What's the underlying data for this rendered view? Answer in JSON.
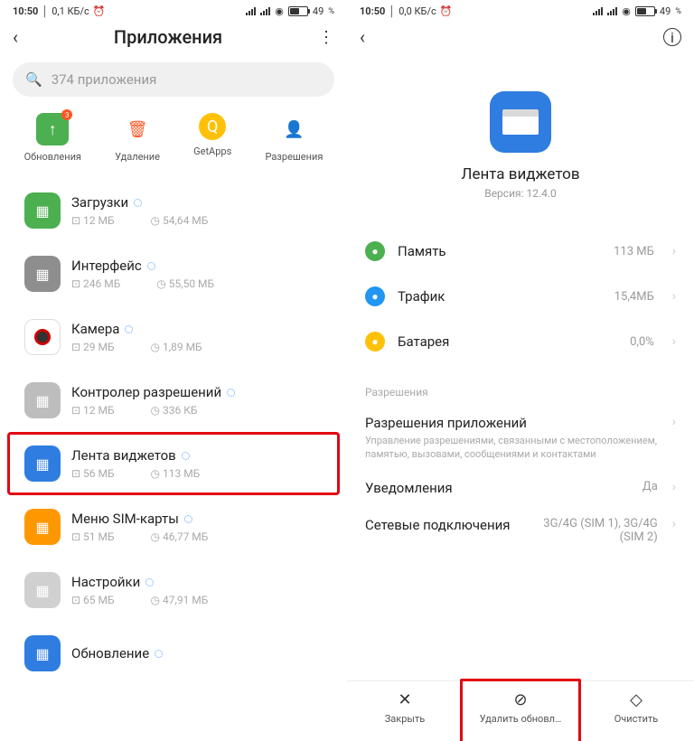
{
  "status": {
    "time": "10:50",
    "speed_l": "0,1 КБ/с",
    "speed_r": "0,0 КБ/с",
    "battery": "49"
  },
  "left": {
    "title": "Приложения",
    "search_placeholder": "374 приложения",
    "quick": [
      {
        "label": "Обновления",
        "badge": "3"
      },
      {
        "label": "Удаление"
      },
      {
        "label": "GetApps"
      },
      {
        "label": "Разрешения"
      }
    ],
    "apps": [
      {
        "name": "Загрузки",
        "install": "12 МБ",
        "storage": "54,64 МБ",
        "color": "#4caf50"
      },
      {
        "name": "Интерфейс",
        "install": "246 МБ",
        "storage": "55,50 МБ",
        "color": "#8e8e8e"
      },
      {
        "name": "Камера",
        "install": "29 МБ",
        "storage": "1,89 МБ",
        "color": "#fff"
      },
      {
        "name": "Контролер разрешений",
        "install": "12 МБ",
        "storage": "336 КБ",
        "color": "#bdbdbd"
      },
      {
        "name": "Лента виджетов",
        "install": "56 МБ",
        "storage": "113 МБ",
        "color": "#2f7de0",
        "hl": true
      },
      {
        "name": "Меню SIM-карты",
        "install": "51 МБ",
        "storage": "46,77 МБ",
        "color": "#ff9800"
      },
      {
        "name": "Настройки",
        "install": "65 МБ",
        "storage": "47,91 МБ",
        "color": "#d0d0d0"
      },
      {
        "name": "Обновление",
        "install": "",
        "storage": "",
        "color": "#2f7de0"
      }
    ]
  },
  "right": {
    "app_name": "Лента виджетов",
    "version": "Версия: 12.4.0",
    "details": [
      {
        "label": "Память",
        "value": "113 МБ",
        "icon_color": "#4caf50"
      },
      {
        "label": "Трафик",
        "value": "15,4МБ",
        "icon_color": "#2196f3"
      },
      {
        "label": "Батарея",
        "value": "0,0%",
        "icon_color": "#ffc107"
      }
    ],
    "perm_section": "Разрешения",
    "perm_rows": [
      {
        "title": "Разрешения приложений",
        "desc": "Управление разрешениями, связанными с местоположением, памятью, вызовами, сообщениями и контактами"
      },
      {
        "title": "Уведомления",
        "value": "Да"
      },
      {
        "title": "Сетевые подключения",
        "value": "3G/4G (SIM 1), 3G/4G (SIM 2)"
      }
    ],
    "actions": [
      {
        "label": "Закрыть"
      },
      {
        "label": "Удалить обновл…",
        "hl": true
      },
      {
        "label": "Очистить"
      }
    ]
  }
}
